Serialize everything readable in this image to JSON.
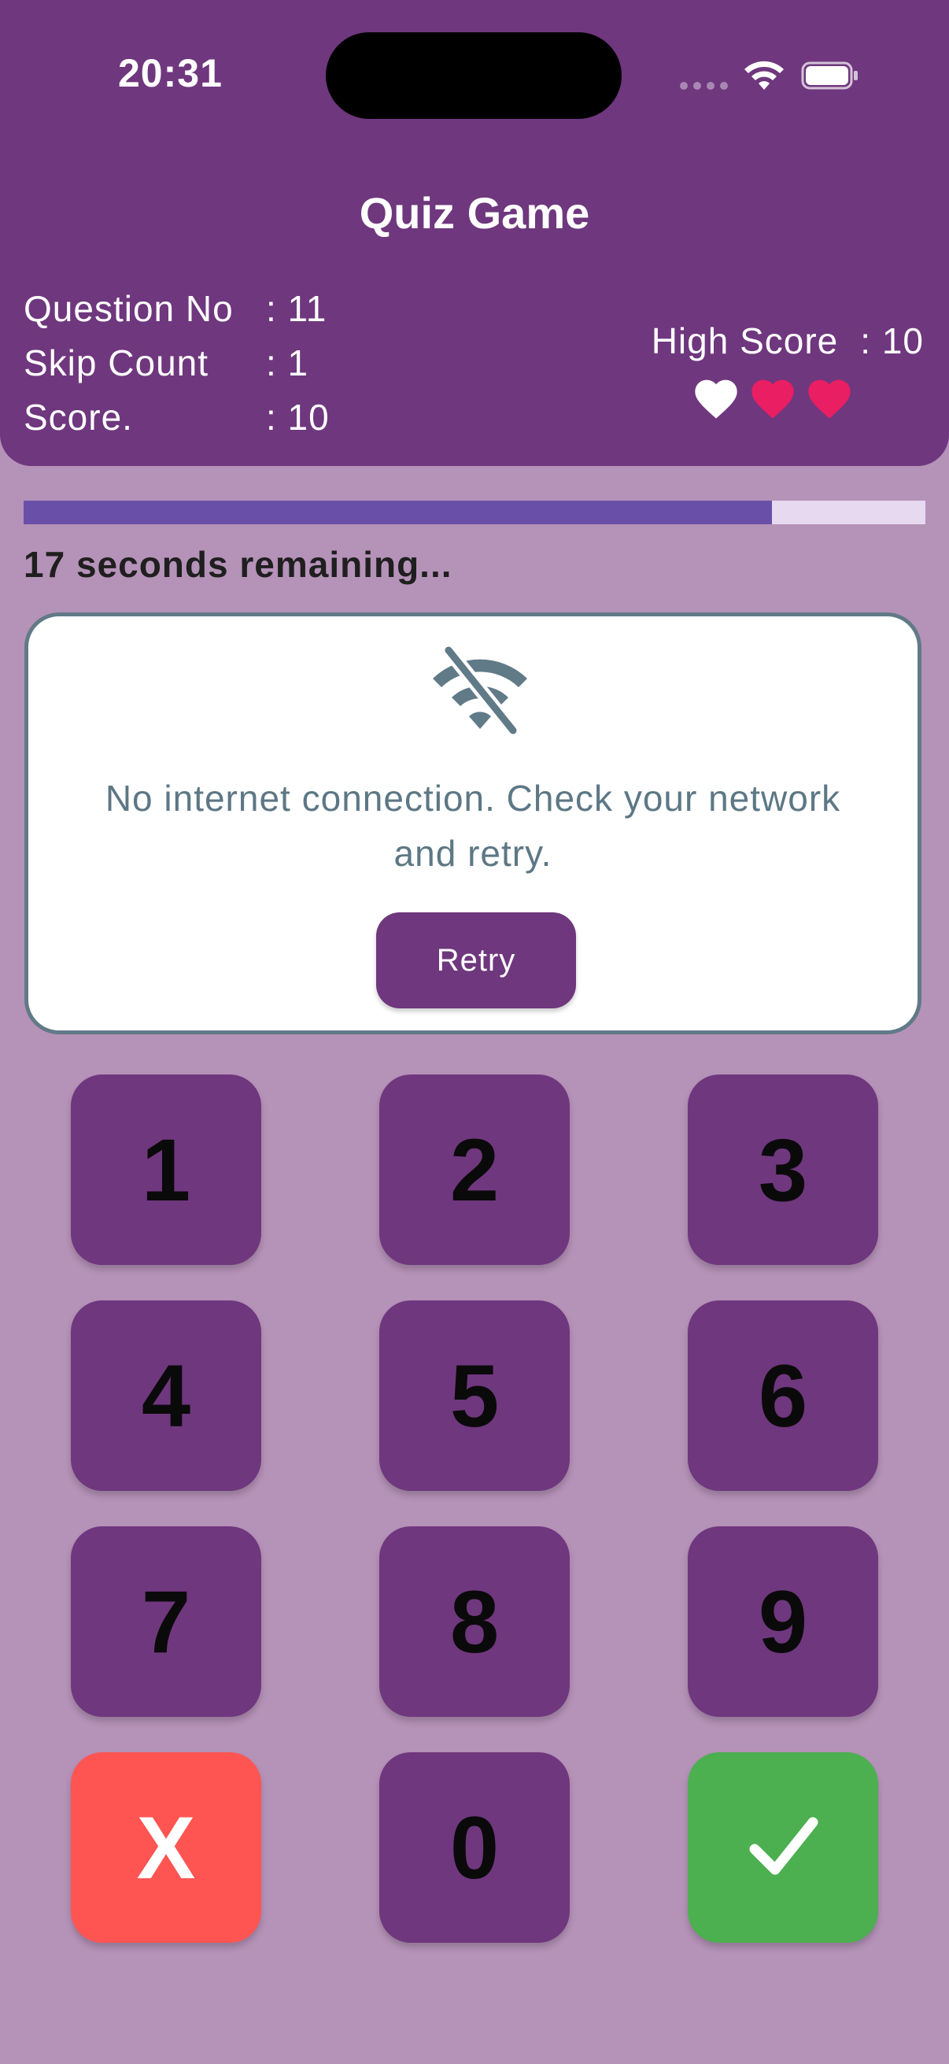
{
  "status_bar": {
    "time": "20:31"
  },
  "header": {
    "title": "Quiz Game",
    "stats": [
      {
        "label": "Question No",
        "value": ": 11"
      },
      {
        "label": "Skip Count",
        "value": ": 1"
      },
      {
        "label": "Score.",
        "value": ": 10"
      }
    ],
    "high_score": {
      "label": "High Score",
      "value": ": 10"
    },
    "lives": {
      "total": 3,
      "lost": 1
    }
  },
  "timer": {
    "text": "17 seconds remaining...",
    "progress": 0.83
  },
  "error_card": {
    "icon": "wifi-off-icon",
    "message": "No internet connection. Check your network and retry.",
    "retry_label": "Retry"
  },
  "keypad": {
    "keys": [
      "1",
      "2",
      "3",
      "4",
      "5",
      "6",
      "7",
      "8",
      "9",
      "X",
      "0",
      ""
    ],
    "cancel_label": "X",
    "confirm_icon": "check-icon"
  },
  "colors": {
    "primary": "#6f377e",
    "background": "#b592b8",
    "progress": "#6a4fa8",
    "heart": "#e91e63",
    "cancel": "#fe5552",
    "confirm": "#4caf50"
  }
}
